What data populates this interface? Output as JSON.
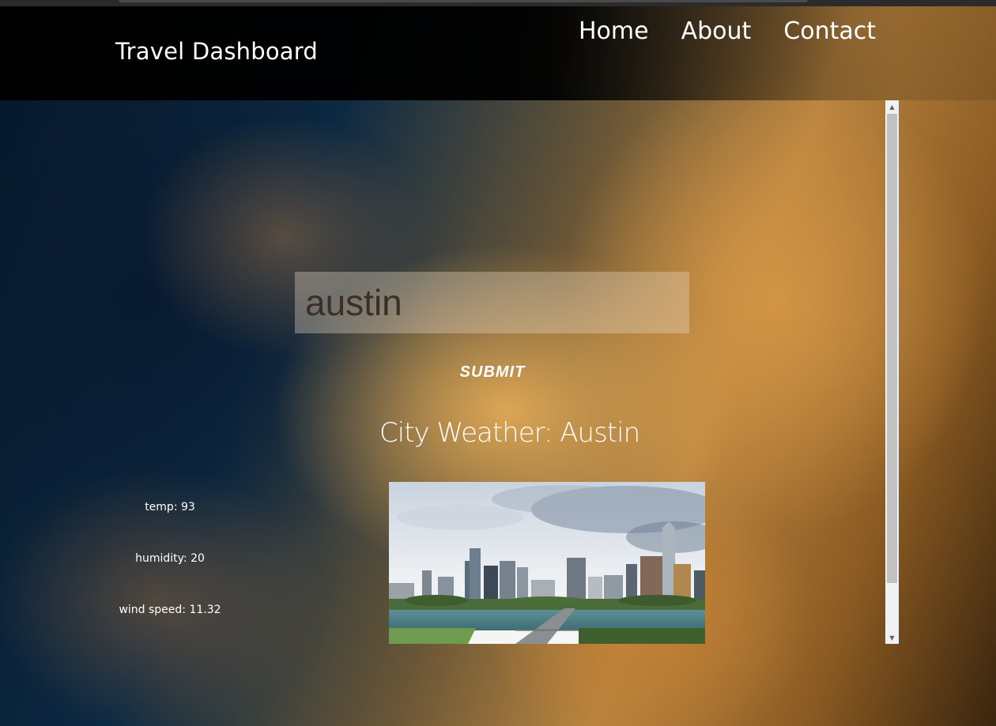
{
  "header": {
    "brand": "Travel Dashboard",
    "nav": [
      "Home",
      "About",
      "Contact"
    ]
  },
  "search": {
    "value": "austin",
    "submit_label": "SUBMIT"
  },
  "weather": {
    "title": "City Weather: Austin",
    "temp": "temp: 93",
    "humidity": "humidity: 20",
    "wind": "wind speed: 11.32"
  },
  "image": {
    "alt": "Austin skyline over the river"
  },
  "scroll": {
    "position_fraction": 0.0
  }
}
